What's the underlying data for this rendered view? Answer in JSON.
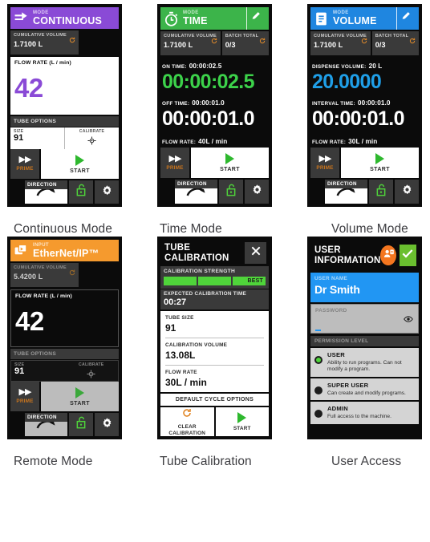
{
  "panels": {
    "continuous": {
      "caption": "Continuous Mode",
      "header": {
        "label": "MODE",
        "value": "CONTINUOUS",
        "icon": "arrow-right-continuous-icon",
        "color": "#8a4ad6"
      },
      "cumulative": {
        "label": "CUMULATIVE VOLUME",
        "value": "1.7100 L"
      },
      "flow": {
        "label": "FLOW RATE (L / min)",
        "value": "42"
      },
      "tube": {
        "header": "TUBE OPTIONS",
        "size_label": "SIZE",
        "size_value": "91",
        "calibrate_label": "CALIBRATE"
      },
      "prime": "PRIME",
      "start": "START",
      "direction": "DIRECTION"
    },
    "time": {
      "caption": "Time Mode",
      "header": {
        "label": "MODE",
        "value": "TIME",
        "icon": "stopwatch-icon",
        "color": "#3cb44a"
      },
      "cumulative": {
        "label": "CUMULATIVE VOLUME",
        "value": "1.7100 L"
      },
      "batch": {
        "label": "BATCH TOTAL",
        "value": "0/3"
      },
      "on_time": {
        "label": "ON TIME:",
        "small": "00:00:02.5",
        "big": "00:00:02.5"
      },
      "off_time": {
        "label": "OFF TIME:",
        "small": "00:00:01.0",
        "big": "00:00:01.0"
      },
      "flow": {
        "label": "FLOW RATE:",
        "value": "40L / min"
      },
      "prime": "PRIME",
      "start": "START",
      "direction": "DIRECTION"
    },
    "volume": {
      "caption": "Volume Mode",
      "header": {
        "label": "MODE",
        "value": "VOLUME",
        "icon": "volume-container-icon",
        "color": "#1f86e0"
      },
      "cumulative": {
        "label": "CUMULATIVE VOLUME",
        "value": "1.7100 L"
      },
      "batch": {
        "label": "BATCH TOTAL",
        "value": "0/3"
      },
      "dispense": {
        "label": "DISPENSE VOLUME:",
        "small": "20 L",
        "big": "20.0000"
      },
      "interval": {
        "label": "INTERVAL TIME:",
        "small": "00:00:01.0",
        "big": "00:00:01.0"
      },
      "flow": {
        "label": "FLOW RATE:",
        "value": "30L / min"
      },
      "prime": "PRIME",
      "start": "START",
      "direction": "DIRECTION"
    },
    "remote": {
      "caption": "Remote Mode",
      "header": {
        "label": "INPUT",
        "value": "EtherNet/IP™",
        "icon": "network-input-icon",
        "color": "#f59a2e"
      },
      "cumulative": {
        "label": "CUMULATIVE VOLUME",
        "value": "5.4200 L"
      },
      "flow": {
        "label": "FLOW RATE (L / min)",
        "value": "42"
      },
      "tube": {
        "header": "TUBE OPTIONS",
        "size_label": "SIZE",
        "size_value": "91",
        "calibrate_label": "CALIBRATE"
      },
      "prime": "PRIME",
      "start": "START",
      "direction": "DIRECTION"
    },
    "calibration": {
      "caption": "Tube Calibration",
      "title": "TUBE CALIBRATION",
      "strength_label": "CALIBRATION STRENGTH",
      "strength_best": "BEST",
      "expected_label": "EXPECTED CALIBRATION TIME",
      "expected_value": "00:27",
      "fields": [
        {
          "label": "TUBE SIZE",
          "value": "91"
        },
        {
          "label": "CALIBRATION VOLUME",
          "value": "13.08L"
        },
        {
          "label": "FLOW RATE",
          "value": "30L / min"
        }
      ],
      "default_cycle": "DEFAULT CYCLE OPTIONS",
      "clear": "CLEAR CALIBRATION",
      "start": "START"
    },
    "user": {
      "caption": "User Access",
      "title": "USER INFORMATION",
      "username": {
        "label": "USER NAME",
        "value": "Dr Smith"
      },
      "password": {
        "label": "PASSWORD",
        "value": ""
      },
      "permission_header": "PERMISSION LEVEL",
      "permissions": [
        {
          "name": "USER",
          "desc": "Ability to run programs. Can not modify a program.",
          "selected": true
        },
        {
          "name": "SUPER USER",
          "desc": "Can create and modify programs.",
          "selected": false
        },
        {
          "name": "ADMIN",
          "desc": "Full access to the machine.",
          "selected": false
        }
      ]
    }
  }
}
